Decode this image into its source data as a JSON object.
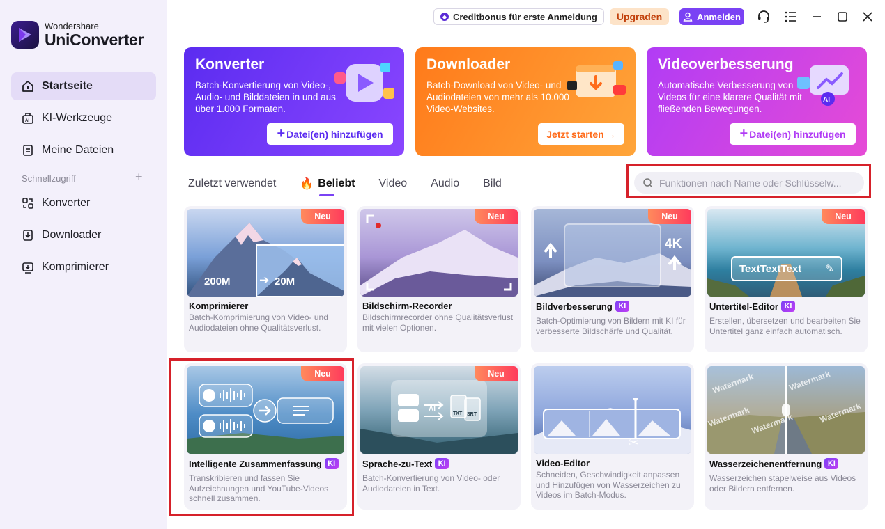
{
  "app": {
    "brand_small": "Wondershare",
    "brand_name": "UniConverter"
  },
  "sidebar": {
    "items": [
      {
        "label": "Startseite",
        "icon": "home-icon",
        "active": true
      },
      {
        "label": "KI-Werkzeuge",
        "icon": "ai-tools-icon"
      },
      {
        "label": "Meine Dateien",
        "icon": "files-icon"
      }
    ],
    "quick_access_label": "Schnellzugriff",
    "quick_items": [
      {
        "label": "Konverter",
        "icon": "converter-icon"
      },
      {
        "label": "Downloader",
        "icon": "downloader-icon"
      },
      {
        "label": "Komprimierer",
        "icon": "compressor-icon"
      }
    ]
  },
  "topbar": {
    "credit": "Creditbonus für erste Anmeldung",
    "upgrade": "Upgraden",
    "login": "Anmelden"
  },
  "hero": [
    {
      "title": "Konverter",
      "desc": "Batch-Konvertierung von Video-, Audio- und Bilddateien in und aus über 1.000 Formaten.",
      "button": "Datei(en) hinzufügen"
    },
    {
      "title": "Downloader",
      "desc": "Batch-Download von Video- und Audiodateien von mehr als 10.000 Video-Websites.",
      "button": "Jetzt starten"
    },
    {
      "title": "Videoverbesserung",
      "desc": "Automatische Verbesserung von Videos für eine klarere Qualität mit fließenden Bewegungen.",
      "button": "Datei(en) hinzufügen"
    }
  ],
  "tabs": [
    "Zuletzt verwendet",
    "Beliebt",
    "Video",
    "Audio",
    "Bild"
  ],
  "search": {
    "placeholder": "Funktionen nach Name oder Schlüsselw..."
  },
  "badges": {
    "new": "Neu",
    "ki": "KI"
  },
  "cards": [
    {
      "title": "Komprimierer",
      "desc": "Batch-Komprimierung von Video- und Audiodateien ohne Qualitätsverlust.",
      "from": "200M",
      "to": "20M"
    },
    {
      "title": "Bildschirm-Recorder",
      "desc": "Bildschirmrecorder ohne Qualitätsverlust mit vielen Optionen."
    },
    {
      "title": "Bildverbesserung",
      "desc": "Batch-Optimierung von Bildern mit KI für verbesserte Bildschärfe und Qualität.",
      "res": "4K"
    },
    {
      "title": "Untertitel-Editor",
      "desc": "Erstellen, übersetzen und bearbeiten Sie Untertitel ganz einfach automatisch.",
      "sample": "TextTextText"
    },
    {
      "title": "Intelligente Zusammenfassung",
      "desc": "Transkribieren und fassen Sie Aufzeichnungen und YouTube-Videos schnell zusammen."
    },
    {
      "title": "Sprache-zu-Text",
      "desc": "Batch-Konvertierung von Video- oder Audiodateien in Text.",
      "ai": "AI",
      "txt": "TXT",
      "srt": "SRT"
    },
    {
      "title": "Video-Editor",
      "desc": "Schneiden, Geschwindigkeit anpassen und Hinzufügen von Wasserzeichen zu Videos im Batch-Modus."
    },
    {
      "title": "Wasserzeichenentfernung",
      "desc": "Wasserzeichen stapelweise aus Videos oder Bildern entfernen.",
      "watermark": "Watermark"
    }
  ]
}
